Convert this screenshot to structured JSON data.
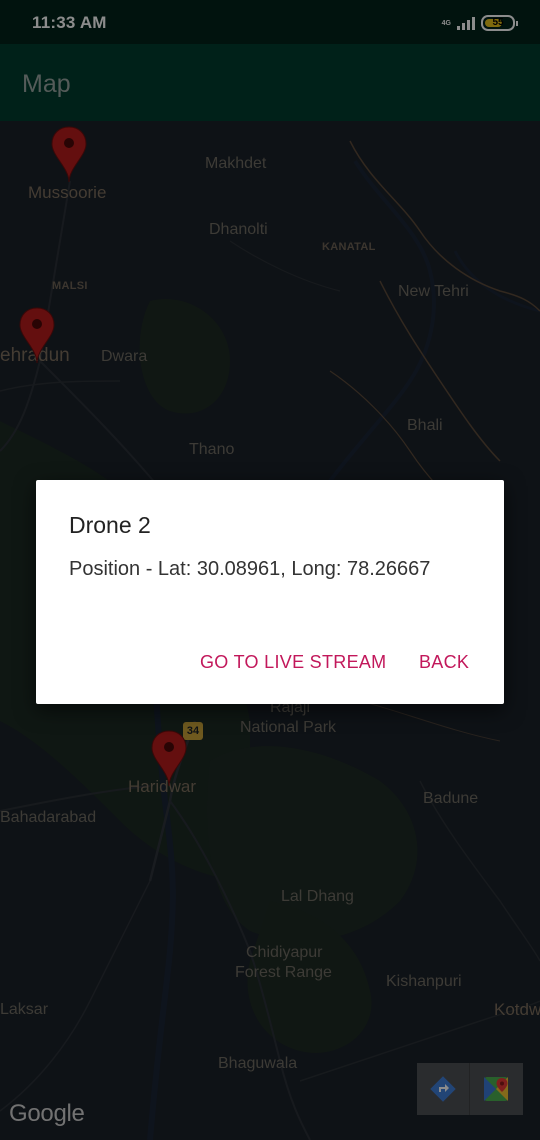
{
  "status_bar": {
    "time": "11:33 AM",
    "network": "4G",
    "battery": "55"
  },
  "app_bar": {
    "title": "Map"
  },
  "map": {
    "places": {
      "mussoorie": "Mussoorie",
      "makhdet": "Makhdet",
      "dhanolti": "Dhanolti",
      "kanatal": "KANATAL",
      "malsi": "MALSI",
      "new_tehri": "New Tehri",
      "dehradun": "ehradun",
      "dwara": "Dwara",
      "thano": "Thano",
      "bhali": "Bhali",
      "rajaji": "Rajaji",
      "national_park": "National Park",
      "haridwar": "Haridwar",
      "bahadarabad": "Bahadarabad",
      "badune": "Badune",
      "lal_dhang": "Lal Dhang",
      "chidiyapur": "Chidiyapur",
      "forest_range": "Forest Range",
      "kishanpuri": "Kishanpuri",
      "laksar": "Laksar",
      "kotdw": "Kotdw",
      "bhaguwala": "Bhaguwala"
    },
    "route_badge": "34",
    "attribution": "Google",
    "marker_color": "#b71c1c"
  },
  "dialog": {
    "title": "Drone 2",
    "message": "Position - Lat: 30.08961, Long: 78.26667",
    "live_stream_button": "GO TO LIVE STREAM",
    "back_button": "BACK",
    "accent_color": "#c2185b"
  },
  "map_toolbar": {
    "directions_icon": "directions-icon",
    "maps_icon": "google-maps-icon"
  }
}
